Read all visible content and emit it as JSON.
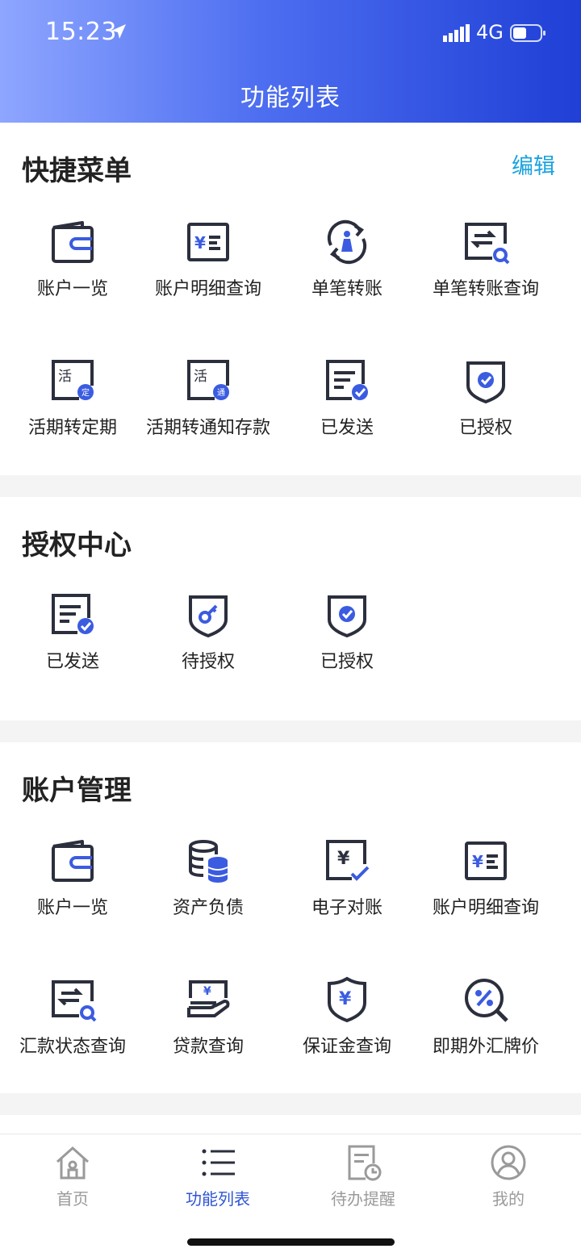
{
  "status": {
    "time": "15:23",
    "network": "4G"
  },
  "page_title": "功能列表",
  "quick_menu": {
    "title": "快捷菜单",
    "edit_label": "编辑",
    "items": [
      {
        "label": "账户一览",
        "icon": "wallet-icon"
      },
      {
        "label": "账户明细查询",
        "icon": "yuan-statement-icon"
      },
      {
        "label": "单笔转账",
        "icon": "transfer-person-icon"
      },
      {
        "label": "单笔转账查询",
        "icon": "transfer-search-icon"
      },
      {
        "label": "活期转定期",
        "icon": "current-to-fixed-icon"
      },
      {
        "label": "活期转通知存款",
        "icon": "current-to-notice-icon"
      },
      {
        "label": "已发送",
        "icon": "sent-document-icon"
      },
      {
        "label": "已授权",
        "icon": "authorized-shield-icon"
      }
    ]
  },
  "auth_center": {
    "title": "授权中心",
    "items": [
      {
        "label": "已发送",
        "icon": "sent-document-icon"
      },
      {
        "label": "待授权",
        "icon": "key-shield-icon"
      },
      {
        "label": "已授权",
        "icon": "authorized-shield-icon"
      }
    ]
  },
  "account_mgmt": {
    "title": "账户管理",
    "items": [
      {
        "label": "账户一览",
        "icon": "wallet-icon"
      },
      {
        "label": "资产负债",
        "icon": "coins-stack-icon"
      },
      {
        "label": "电子对账",
        "icon": "reconcile-icon"
      },
      {
        "label": "账户明细查询",
        "icon": "yuan-statement-icon"
      },
      {
        "label": "汇款状态查询",
        "icon": "transfer-search-icon"
      },
      {
        "label": "贷款查询",
        "icon": "loan-hand-icon"
      },
      {
        "label": "保证金查询",
        "icon": "yuan-shield-icon"
      },
      {
        "label": "即期外汇牌价",
        "icon": "percent-search-icon"
      }
    ]
  },
  "tabbar": {
    "items": [
      {
        "label": "首页",
        "icon": "home-icon",
        "active": false
      },
      {
        "label": "功能列表",
        "icon": "list-icon",
        "active": true
      },
      {
        "label": "待办提醒",
        "icon": "todo-clock-icon",
        "active": false
      },
      {
        "label": "我的",
        "icon": "user-icon",
        "active": false
      }
    ]
  },
  "colors": {
    "accent": "#2f55d4",
    "icon_dark": "#2b2f3d",
    "edit": "#19a3de"
  }
}
